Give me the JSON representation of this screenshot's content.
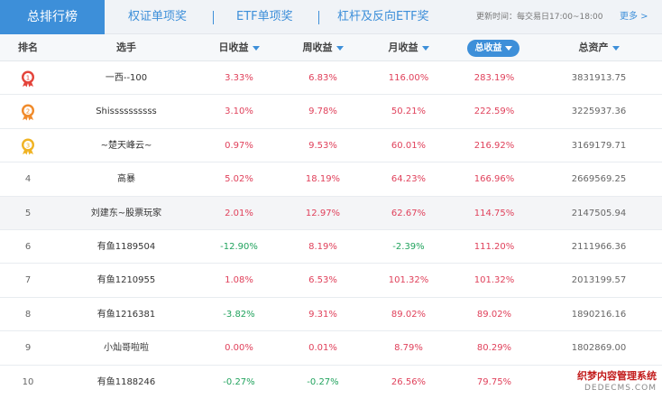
{
  "tabs": {
    "active": "总排行榜",
    "items": [
      "权证单项奖",
      "ETF单项奖",
      "杠杆及反向ETF奖"
    ],
    "separator": "|"
  },
  "update_note": "更新时间：每交易日17:00~18:00",
  "more_link": "更多 >",
  "columns": {
    "rank": "排名",
    "name": "选手",
    "day": "日收益",
    "week": "周收益",
    "month": "月收益",
    "total": "总收益",
    "assets": "总资产"
  },
  "rows": [
    {
      "rank": "1",
      "name": "一西--100",
      "day": "3.33%",
      "week": "6.83%",
      "month": "116.00%",
      "total": "283.19%",
      "assets": "3831913.75"
    },
    {
      "rank": "2",
      "name": "Shissssssssss",
      "day": "3.10%",
      "week": "9.78%",
      "month": "50.21%",
      "total": "222.59%",
      "assets": "3225937.36"
    },
    {
      "rank": "3",
      "name": "~楚天峰云~",
      "day": "0.97%",
      "week": "9.53%",
      "month": "60.01%",
      "total": "216.92%",
      "assets": "3169179.71"
    },
    {
      "rank": "4",
      "name": "高暴",
      "day": "5.02%",
      "week": "18.19%",
      "month": "64.23%",
      "total": "166.96%",
      "assets": "2669569.25"
    },
    {
      "rank": "5",
      "name": "刘建东~股票玩家",
      "day": "2.01%",
      "week": "12.97%",
      "month": "62.67%",
      "total": "114.75%",
      "assets": "2147505.94"
    },
    {
      "rank": "6",
      "name": "有鱼1189504",
      "day": "-12.90%",
      "week": "8.19%",
      "month": "-2.39%",
      "total": "111.20%",
      "assets": "2111966.36"
    },
    {
      "rank": "7",
      "name": "有鱼1210955",
      "day": "1.08%",
      "week": "6.53%",
      "month": "101.32%",
      "total": "101.32%",
      "assets": "2013199.57"
    },
    {
      "rank": "8",
      "name": "有鱼1216381",
      "day": "-3.82%",
      "week": "9.31%",
      "month": "89.02%",
      "total": "89.02%",
      "assets": "1890216.16"
    },
    {
      "rank": "9",
      "name": "小灿哥啦啦",
      "day": "0.00%",
      "week": "0.01%",
      "month": "8.79%",
      "total": "80.29%",
      "assets": "1802869.00"
    },
    {
      "rank": "10",
      "name": "有鱼1188246",
      "day": "-0.27%",
      "week": "-0.27%",
      "month": "26.56%",
      "total": "79.75%",
      "assets": ""
    }
  ],
  "medals": [
    {
      "name": "medal-icon-1",
      "color": "#e4433a"
    },
    {
      "name": "medal-icon-2",
      "color": "#f08a2a"
    },
    {
      "name": "medal-icon-3",
      "color": "#f0b323"
    }
  ],
  "colors": {
    "accent": "#3d8fd9",
    "positive": "#e0415b",
    "negative": "#22a35e",
    "highlight_row": "#f4f5f7"
  },
  "watermark": {
    "line1": "织梦内容管理系统",
    "line2": "DEDECMS.COM"
  }
}
